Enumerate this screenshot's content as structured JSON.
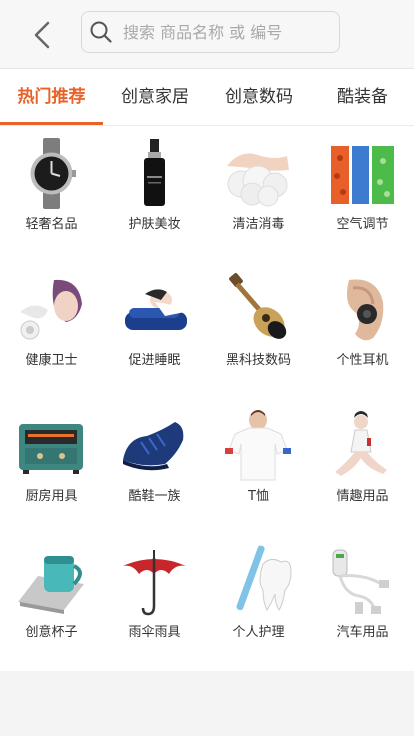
{
  "header": {
    "search_placeholder": "搜索 商品名称 或 编号"
  },
  "tabs": [
    {
      "label": "热门推荐",
      "active": true
    },
    {
      "label": "创意家居",
      "active": false
    },
    {
      "label": "创意数码",
      "active": false
    },
    {
      "label": "酷装备",
      "active": false
    }
  ],
  "categories": [
    {
      "label": "轻奢名品",
      "icon": "watch-icon"
    },
    {
      "label": "护肤美妆",
      "icon": "skincare-bottle-icon"
    },
    {
      "label": "清洁消毒",
      "icon": "foam-hands-icon"
    },
    {
      "label": "空气调节",
      "icon": "air-filter-icon"
    },
    {
      "label": "健康卫士",
      "icon": "health-mask-icon"
    },
    {
      "label": "促进睡眠",
      "icon": "pillow-icon"
    },
    {
      "label": "黑科技数码",
      "icon": "ukulele-icon"
    },
    {
      "label": "个性耳机",
      "icon": "earbud-icon"
    },
    {
      "label": "厨房用具",
      "icon": "oven-icon"
    },
    {
      "label": "酷鞋一族",
      "icon": "shoe-icon"
    },
    {
      "label": "T恤",
      "icon": "tshirt-icon"
    },
    {
      "label": "情趣用品",
      "icon": "figure-icon"
    },
    {
      "label": "创意杯子",
      "icon": "cup-icon"
    },
    {
      "label": "雨伞雨具",
      "icon": "umbrella-icon"
    },
    {
      "label": "个人护理",
      "icon": "toothbrush-icon"
    },
    {
      "label": "汽车用品",
      "icon": "car-charger-icon"
    }
  ]
}
